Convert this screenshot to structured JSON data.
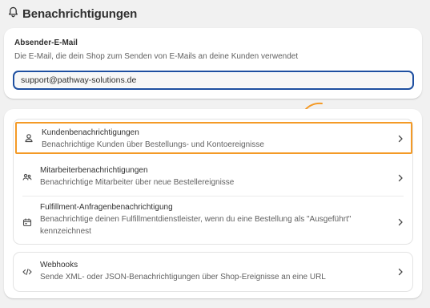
{
  "header": {
    "title": "Benachrichtigungen",
    "icon": "bell-icon"
  },
  "sender": {
    "label": "Absender-E-Mail",
    "description": "Die E-Mail, die dein Shop zum Senden von E-Mails an deine Kunden verwendet",
    "value": "support@pathway-solutions.de"
  },
  "notifications": [
    {
      "icon": "person-icon",
      "title": "Kundenbenachrichtigungen",
      "description": "Benachrichtige Kunden über Bestellungs- und Kontoereignisse",
      "highlighted": true,
      "highlight_color": "#f49a26"
    },
    {
      "icon": "staff-icon",
      "title": "Mitarbeiterbenachrichtigungen",
      "description": "Benachrichtige Mitarbeiter über neue Bestellereignisse"
    },
    {
      "icon": "fulfillment-icon",
      "title": "Fulfillment-Anfragenbenachrichtigung",
      "description_line1": "Benachrichtige deinen Fulfillmentdienstleister, wenn du eine Bestellung als \"Ausgeführt\"",
      "description_line2": "kennzeichnest"
    }
  ],
  "webhooks": {
    "icon": "code-icon",
    "title": "Webhooks",
    "description": "Sende XML- oder JSON-Benachrichtigungen über Shop-Ereignisse an eine URL"
  },
  "colors": {
    "accent_highlight": "#f49a26",
    "focus_ring": "#1e4fa0",
    "background": "#f1f1f1"
  }
}
